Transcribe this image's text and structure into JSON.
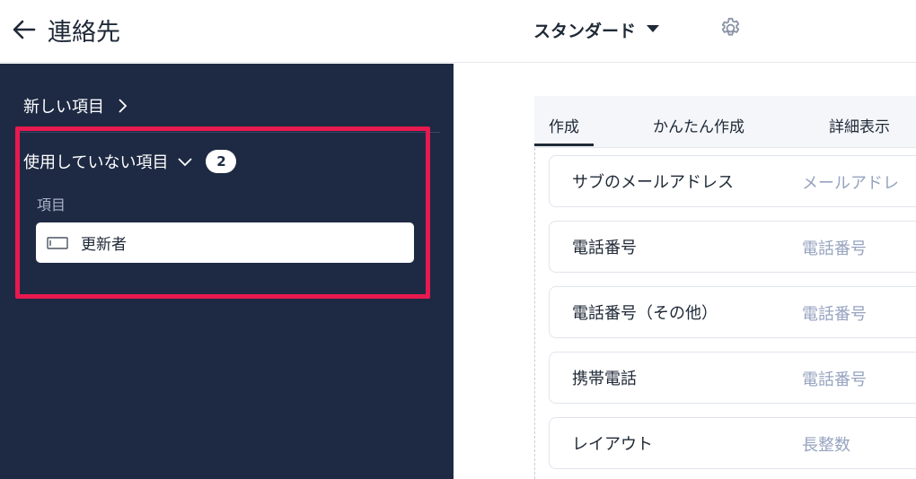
{
  "header": {
    "title": "連絡先",
    "view_select": "スタンダード"
  },
  "sidebar": {
    "new_items": "新しい項目",
    "unused_items": "使用していない項目",
    "unused_count": "2",
    "section_label": "項目",
    "unused_fields": [
      {
        "label": "更新者"
      }
    ]
  },
  "tabs": [
    "作成",
    "かんたん作成",
    "詳細表示"
  ],
  "fields": [
    {
      "label": "サブのメールアドレス",
      "placeholder": "メールアドレ"
    },
    {
      "label": "電話番号",
      "placeholder": "電話番号"
    },
    {
      "label": "電話番号（その他）",
      "placeholder": "電話番号"
    },
    {
      "label": "携帯電話",
      "placeholder": "電話番号"
    },
    {
      "label": "レイアウト",
      "placeholder": "長整数"
    }
  ],
  "colors": {
    "sidebar_bg": "#1e2a44",
    "highlight": "#e8194f",
    "placeholder_text": "#97a3bf"
  },
  "icons": [
    "back-arrow-icon",
    "dropdown-caret-icon",
    "gear-icon",
    "chevron-right-icon",
    "chevron-down-icon",
    "text-field-icon"
  ]
}
